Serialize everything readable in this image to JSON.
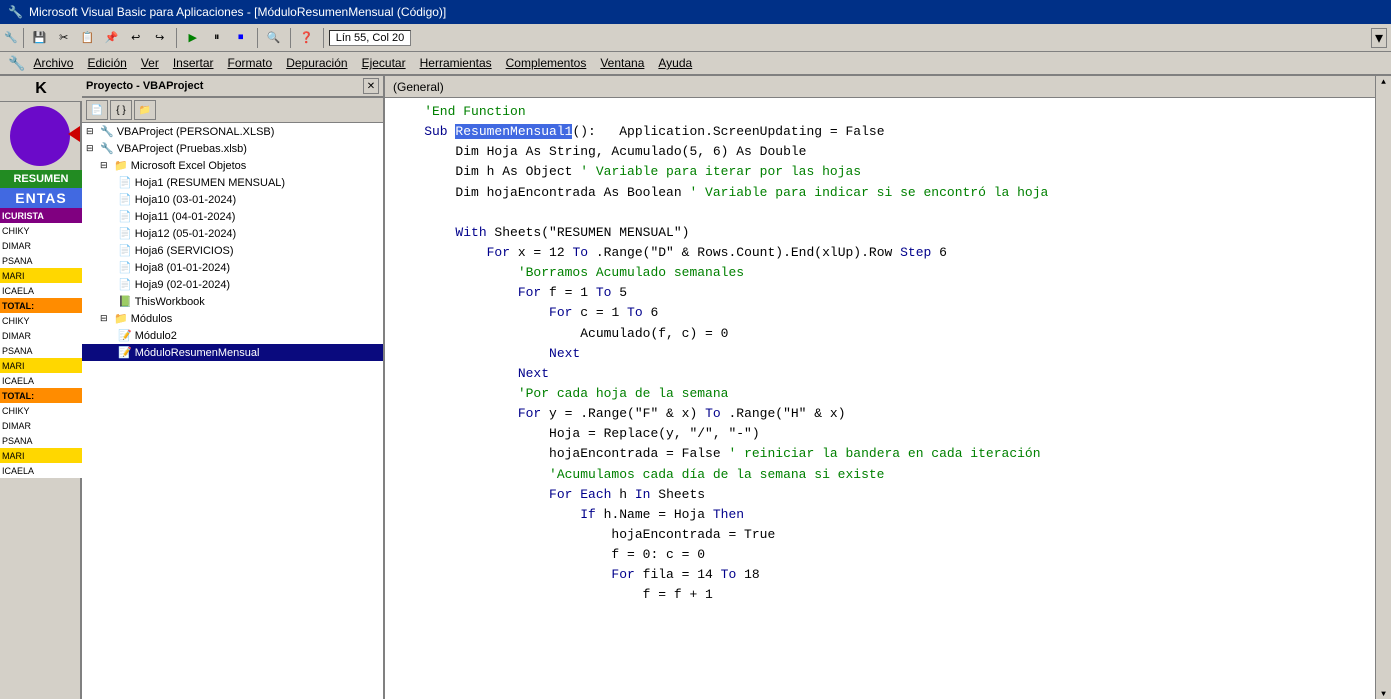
{
  "titleBar": {
    "title": "Microsoft Visual Basic para Aplicaciones - [MóduloResumenMensual (Código)]",
    "icon": "🔧"
  },
  "toolbar": {
    "position": "Lín 55, Col 20",
    "buttons": [
      "💾",
      "✂",
      "📋",
      "🗑",
      "↩",
      "↪",
      "▶",
      "⏸",
      "⏹",
      "🔍",
      "❓"
    ]
  },
  "menuBar": {
    "items": [
      "Archivo",
      "Edición",
      "Ver",
      "Insertar",
      "Formato",
      "Depuración",
      "Ejecutar",
      "Herramientas",
      "Complementos",
      "Ventana",
      "Ayuda"
    ]
  },
  "projectPanel": {
    "title": "Proyecto - VBAProject",
    "treeItems": [
      {
        "id": "vba1",
        "label": "VBAProject (PERSONAL.XLSB)",
        "indent": 0,
        "type": "project",
        "expanded": true
      },
      {
        "id": "vba2",
        "label": "VBAProject (Pruebas.xlsb)",
        "indent": 0,
        "type": "project",
        "expanded": true
      },
      {
        "id": "excel",
        "label": "Microsoft Excel Objetos",
        "indent": 1,
        "type": "folder",
        "expanded": true
      },
      {
        "id": "h1",
        "label": "Hoja1 (RESUMEN MENSUAL)",
        "indent": 2,
        "type": "sheet"
      },
      {
        "id": "h10",
        "label": "Hoja10 (03-01-2024)",
        "indent": 2,
        "type": "sheet"
      },
      {
        "id": "h11",
        "label": "Hoja11 (04-01-2024)",
        "indent": 2,
        "type": "sheet"
      },
      {
        "id": "h12",
        "label": "Hoja12 (05-01-2024)",
        "indent": 2,
        "type": "sheet"
      },
      {
        "id": "h6",
        "label": "Hoja6 (SERVICIOS)",
        "indent": 2,
        "type": "sheet"
      },
      {
        "id": "h8",
        "label": "Hoja8 (01-01-2024)",
        "indent": 2,
        "type": "sheet"
      },
      {
        "id": "h9",
        "label": "Hoja9 (02-01-2024)",
        "indent": 2,
        "type": "sheet"
      },
      {
        "id": "tw",
        "label": "ThisWorkbook",
        "indent": 2,
        "type": "workbook"
      },
      {
        "id": "mod",
        "label": "Módulos",
        "indent": 1,
        "type": "folder",
        "expanded": true
      },
      {
        "id": "mod2",
        "label": "Módulo2",
        "indent": 2,
        "type": "module"
      },
      {
        "id": "modRM",
        "label": "MóduloResumenMensual",
        "indent": 2,
        "type": "module",
        "selected": true
      }
    ]
  },
  "codePanel": {
    "header": "(General)",
    "lines": [
      {
        "type": "comment",
        "text": "    'End Function"
      },
      {
        "type": "mixed",
        "text": "    Sub ResumenMensual1():   Application.ScreenUpdating = False",
        "highlight": "ResumenMensual1"
      },
      {
        "type": "normal",
        "text": "        Dim Hoja As String, Acumulado(5, 6) As Double"
      },
      {
        "type": "comment2",
        "text": "        Dim h As Object ' Variable para iterar por las hojas"
      },
      {
        "type": "comment2",
        "text": "        Dim hojaEncontrada As Boolean ' Variable para indicar si se encontró la hoja"
      },
      {
        "type": "blank",
        "text": ""
      },
      {
        "type": "normal",
        "text": "        With Sheets(\"RESUMEN MENSUAL\")"
      },
      {
        "type": "normal",
        "text": "            For x = 12 To .Range(\"D\" & Rows.Count).End(xlUp).Row Step 6"
      },
      {
        "type": "comment",
        "text": "                'Borramos Acumulado semanales"
      },
      {
        "type": "normal",
        "text": "                For f = 1 To 5"
      },
      {
        "type": "normal",
        "text": "                    For c = 1 To 6"
      },
      {
        "type": "normal",
        "text": "                        Acumulado(f, c) = 0"
      },
      {
        "type": "normal",
        "text": "                    Next"
      },
      {
        "type": "normal",
        "text": "                Next"
      },
      {
        "type": "comment",
        "text": "                'Por cada hoja de la semana"
      },
      {
        "type": "normal",
        "text": "                For y = .Range(\"F\" & x) To .Range(\"H\" & x)"
      },
      {
        "type": "normal",
        "text": "                    Hoja = Replace(y, \"/\", \"-\")"
      },
      {
        "type": "comment2",
        "text": "                    hojaEncontrada = False ' reiniciar la bandera en cada iteración"
      },
      {
        "type": "comment",
        "text": "                    'Acumulamos cada día de la semana si existe"
      },
      {
        "type": "normal",
        "text": "                    For Each h In Sheets"
      },
      {
        "type": "normal",
        "text": "                        If h.Name = Hoja Then"
      },
      {
        "type": "normal",
        "text": "                            hojaEncontrada = True"
      },
      {
        "type": "normal",
        "text": "                            f = 0: c = 0"
      },
      {
        "type": "normal",
        "text": "                            For fila = 14 To 18"
      },
      {
        "type": "normal",
        "text": "                                f = f + 1"
      }
    ]
  },
  "sidebar": {
    "kLabel": "K",
    "resumenLabel": "RESUMEN",
    "ventasLabel": "ENTAS",
    "colorBlocks": [
      {
        "label": "ICURISTA",
        "color": "purple"
      },
      {
        "label": "CHIKY",
        "color": "white"
      },
      {
        "label": "DIMAR",
        "color": "white"
      },
      {
        "label": "PSANA",
        "color": "white"
      },
      {
        "label": "MARI",
        "color": "yellow"
      },
      {
        "label": "ICAELA",
        "color": "white"
      },
      {
        "label": "TOTAL:",
        "color": "orange-total"
      },
      {
        "label": "CHIKY",
        "color": "white"
      },
      {
        "label": "DIMAR",
        "color": "white"
      },
      {
        "label": "PSANA",
        "color": "white"
      },
      {
        "label": "MARI",
        "color": "yellow"
      },
      {
        "label": "ICAELA",
        "color": "white"
      },
      {
        "label": "TOTAL:",
        "color": "orange-total"
      },
      {
        "label": "CHIKY",
        "color": "white"
      },
      {
        "label": "DIMAR",
        "color": "white"
      },
      {
        "label": "PSANA",
        "color": "white"
      },
      {
        "label": "MARI",
        "color": "yellow"
      },
      {
        "label": "ICAELA",
        "color": "white"
      }
    ]
  }
}
